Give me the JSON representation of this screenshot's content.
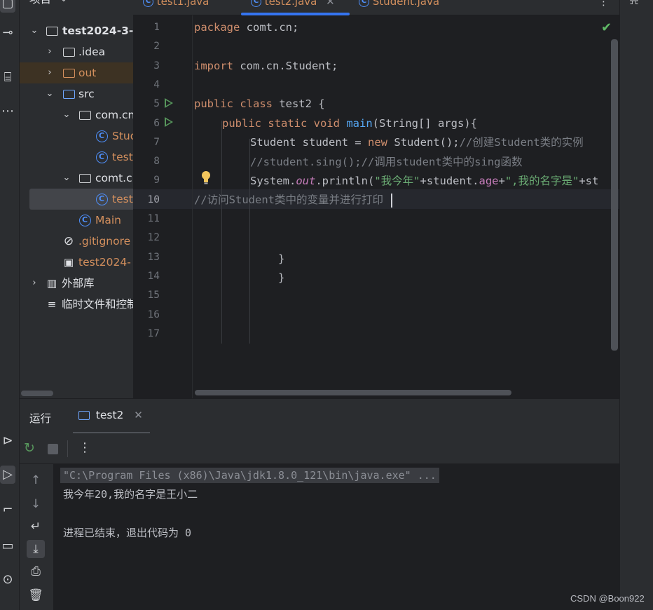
{
  "project_panel": {
    "header_label": "项目",
    "items": [
      {
        "label": "test2024-3-"
      },
      {
        "label": ".idea"
      },
      {
        "label": "out"
      },
      {
        "label": "src"
      },
      {
        "label": "com.cn"
      },
      {
        "label": "Stud"
      },
      {
        "label": "test"
      },
      {
        "label": "comt.cn"
      },
      {
        "label": "test"
      },
      {
        "label": "Main"
      },
      {
        "label": ".gitignore"
      },
      {
        "label": "test2024-"
      },
      {
        "label": "外部库"
      },
      {
        "label": "临时文件和控制"
      }
    ]
  },
  "tabs": [
    {
      "label": "test1.java"
    },
    {
      "label": "test2.java"
    },
    {
      "label": "Student.java"
    }
  ],
  "editor": {
    "line_numbers": [
      "1",
      "2",
      "3",
      "4",
      "5",
      "6",
      "7",
      "8",
      "9",
      "10",
      "11",
      "12",
      "13",
      "14",
      "15",
      "16",
      "17"
    ],
    "code": {
      "l1_kw": "package",
      "l1_rest": " comt.cn;",
      "l3_kw": "import",
      "l3_rest": " com.cn.Student;",
      "l5_kw": "public class",
      "l5_rest": " test2 {",
      "l6_kw": "public static void",
      "l6_fn": "main",
      "l6_rest": "(String[] args){",
      "l7_a": "Student student = ",
      "l7_kw": "new",
      "l7_b": " Student();",
      "l7_cmt": "//创建Student类的实例",
      "l8_cmt": "//student.sing();//调用student类中的sing函数",
      "l9_a": "System.",
      "l9_out": "out",
      "l9_b": ".println(",
      "l9_s1": "\"我今年\"",
      "l9_c": "+student.",
      "l9_age": "age",
      "l9_d": "+",
      "l9_s2": "\",我的名字是\"",
      "l9_e": "+st",
      "l10_cmt": "//访问Student类中的变量并进行打印",
      "l13": "}",
      "l14": "}"
    }
  },
  "run_panel": {
    "title": "运行",
    "tab_label": "test2",
    "console_lines": [
      "\"C:\\Program Files (x86)\\Java\\jdk1.8.0_121\\bin\\java.exe\" ...",
      "我今年20,我的名字是王小二",
      "",
      "进程已结束，退出代码为 0"
    ]
  },
  "watermark": "CSDN @Boon922",
  "colors": {
    "background": "#1e1f22",
    "panel": "#2b2d30",
    "keyword": "#cf8e6d",
    "function": "#56a8f5",
    "string": "#6aab73",
    "field": "#c77dbb",
    "comment": "#7a7e85",
    "accent": "#3574f0"
  }
}
